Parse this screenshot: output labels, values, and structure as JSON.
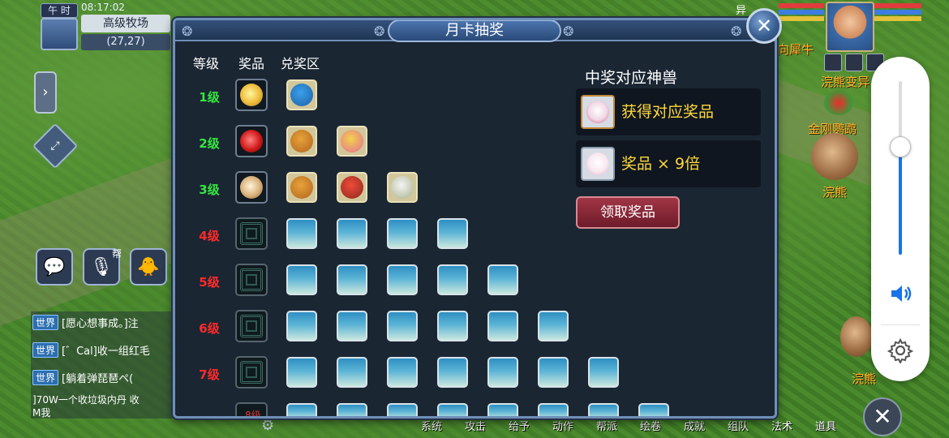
{
  "hud": {
    "time_tag": "午 时",
    "clock": "08:17:02",
    "location": "高级牧场",
    "coords": "(27,27)",
    "chat_badge": "帮",
    "team_label": "异",
    "npc_labels": [
      "向犀牛",
      "浣熊变异",
      "金刚鹦鹉",
      "浣熊",
      "浣熊"
    ]
  },
  "chat": {
    "lines": [
      {
        "channel": "世界",
        "text": "[愿心想事成。]注"
      },
      {
        "channel": "世界",
        "text": "[゛Cal]收一组红毛"
      },
      {
        "channel": "世界",
        "text": "[躺着弹琵琶ペ(  "
      }
    ],
    "extra": [
      "]70W一个收垃圾内丹 收",
      "M我"
    ]
  },
  "menu": [
    "系统",
    "攻击",
    "给予",
    "动作",
    "帮派",
    "绘卷",
    "成就",
    "组队",
    "法术",
    "道具"
  ],
  "dialog": {
    "title": "月卡抽奖",
    "close": "✕",
    "col_level": "等级",
    "col_prize": "奖品",
    "col_exchange": "兑奖区",
    "levels": [
      {
        "label": "1级",
        "color": "#33e640",
        "prize": "open",
        "slots": 1,
        "filled": 1
      },
      {
        "label": "2级",
        "color": "#33e640",
        "prize": "open",
        "slots": 2,
        "filled": 2
      },
      {
        "label": "3级",
        "color": "#33e640",
        "prize": "open",
        "slots": 3,
        "filled": 3
      },
      {
        "label": "4级",
        "color": "#ff2a2a",
        "prize": "locked",
        "slots": 4,
        "filled": 0
      },
      {
        "label": "5级",
        "color": "#ff2a2a",
        "prize": "locked",
        "slots": 5,
        "filled": 0
      },
      {
        "label": "6级",
        "color": "#ff2a2a",
        "prize": "locked",
        "slots": 6,
        "filled": 0
      },
      {
        "label": "7级",
        "color": "#ff2a2a",
        "prize": "locked",
        "slots": 7,
        "filled": 0
      }
    ],
    "right_title": "中奖对应神兽",
    "info1": "获得对应奖品",
    "info2": "奖品 × 9倍",
    "claim": "领取奖品"
  },
  "volume": {
    "level": 0.62,
    "accent": "#1a73e8"
  }
}
